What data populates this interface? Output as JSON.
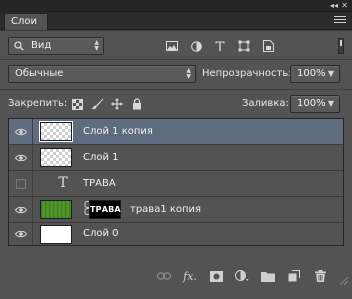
{
  "window": {
    "collapse_glyph": "◂◂",
    "close_glyph": "✕",
    "tab_label": "Слои"
  },
  "filter": {
    "kind_label": "Вид",
    "icons": [
      "image-filter-icon",
      "adjustment-filter-icon",
      "type-filter-icon",
      "shape-filter-icon",
      "smart-object-filter-icon"
    ]
  },
  "blend": {
    "mode_label": "Обычные",
    "opacity_label": "Непрозрачность:",
    "opacity_value": "100%"
  },
  "lock": {
    "label": "Закрепить:",
    "fill_label": "Заливка:",
    "fill_value": "100%"
  },
  "layers": [
    {
      "name": "Слой 1 копия",
      "visible": true,
      "selected": true,
      "thumb": "checker"
    },
    {
      "name": "Слой 1",
      "visible": true,
      "selected": false,
      "thumb": "checker"
    },
    {
      "name": "ТРАВА",
      "visible": false,
      "selected": false,
      "thumb": "type",
      "type_glyph": "T"
    },
    {
      "name": "трава1 копия",
      "visible": true,
      "selected": false,
      "thumb": "grass",
      "mask_text": "ТРАВА"
    },
    {
      "name": "Слой 0",
      "visible": true,
      "selected": false,
      "thumb": "white"
    }
  ],
  "bottom": {
    "fx_label": "fx."
  },
  "colors": {
    "panel_bg": "#535353",
    "selected_row": "#5f6c80",
    "dark_bar": "#2b2b2b"
  }
}
